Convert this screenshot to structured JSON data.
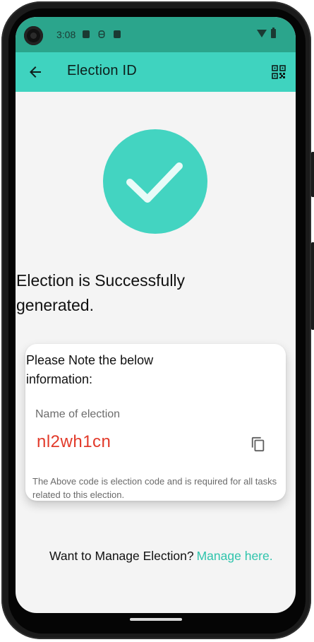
{
  "status_bar": {
    "time": "3:08",
    "icons": [
      "notification-a-icon",
      "notification-s-icon",
      "sd-card-icon",
      "wifi-icon",
      "battery-icon"
    ]
  },
  "app_bar": {
    "title": "Election ID",
    "back_icon": "arrow-back-icon",
    "action_icon": "qr-code-icon",
    "color": "#3fd3bf"
  },
  "main": {
    "success_icon": "check-icon",
    "success_color": "#43d4c1",
    "success_message": "Election is Successfully generated."
  },
  "card": {
    "heading": "Please Note the below information:",
    "label": "Name of election",
    "code": "nl2wh1cn",
    "code_color": "#e23a2a",
    "copy_icon": "copy-icon",
    "note": "The Above code is election code and is required for all tasks related to this election."
  },
  "footer": {
    "prompt": "Want to Manage Election?",
    "link": "Manage here.",
    "link_color": "#2fc4ac"
  }
}
